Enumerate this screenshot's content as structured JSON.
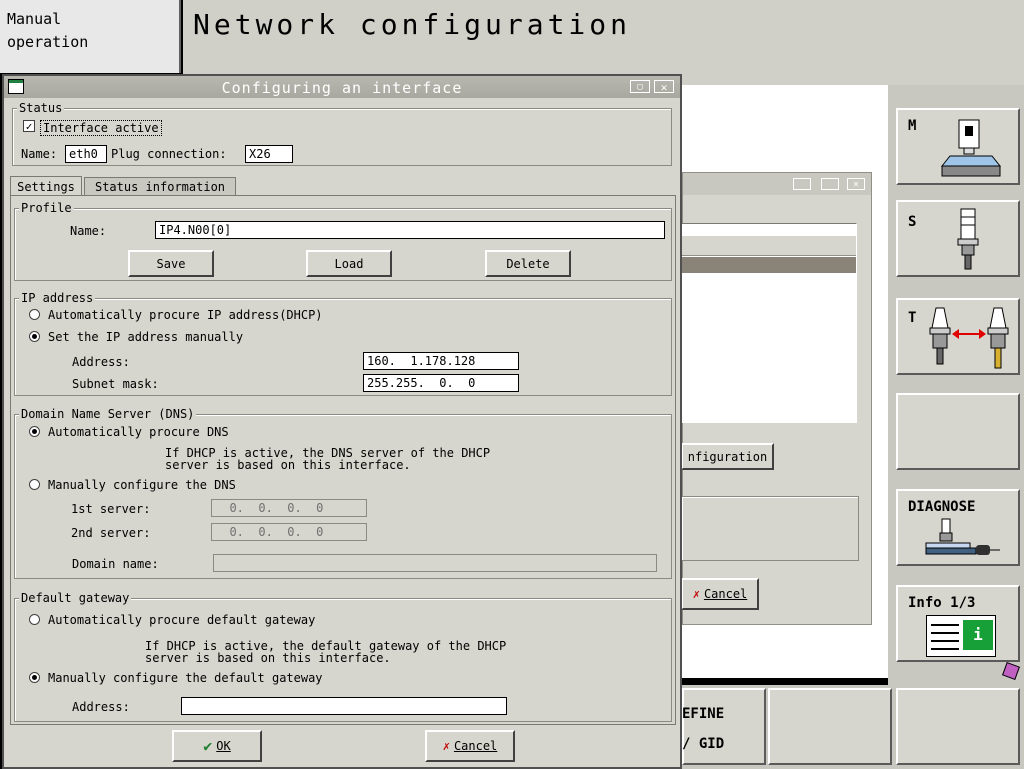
{
  "mode": {
    "line1": "Manual",
    "line2": "operation"
  },
  "screen_title": "Network configuration",
  "dialog": {
    "title": "Configuring an interface",
    "status": {
      "legend": "Status",
      "interface_active_label": "Interface active",
      "interface_active_checked": true,
      "name_label": "Name:",
      "name_value": "eth0",
      "plug_label": "Plug connection:",
      "plug_value": "X26"
    },
    "tabs": [
      "Settings",
      "Status information"
    ],
    "profile": {
      "legend": "Profile",
      "name_label": "Name:",
      "name_value": "IP4.N00[0]",
      "save": "Save",
      "load": "Load",
      "delete": "Delete"
    },
    "ip": {
      "legend": "IP address",
      "opt_auto": "Automatically procure IP address(DHCP)",
      "opt_manual": "Set the IP address manually",
      "address_label": "Address:",
      "address_value": "160.  1.178.128",
      "subnet_label": "Subnet mask:",
      "subnet_value": "255.255.  0.  0"
    },
    "dns": {
      "legend": "Domain Name Server (DNS)",
      "opt_auto": "Automatically procure DNS",
      "note_line1": "If DHCP is active, the DNS server of the DHCP",
      "note_line2": "server is based on this interface.",
      "opt_manual": "Manually configure the DNS",
      "server1_label": "1st server:",
      "server1_value": "  0.  0.  0.  0",
      "server2_label": "2nd server:",
      "server2_value": "  0.  0.  0.  0",
      "domain_label": "Domain name:",
      "domain_value": ""
    },
    "gateway": {
      "legend": "Default gateway",
      "opt_auto": "Automatically procure default gateway",
      "note_line1": "If DHCP is active, the default gateway of the DHCP",
      "note_line2": "server is based on this interface.",
      "opt_manual": "Manually configure the default gateway",
      "address_label": "Address:",
      "address_value": ""
    },
    "ok": "OK",
    "cancel": "Cancel"
  },
  "background_window": {
    "button_partial": "nfiguration",
    "cancel": "Cancel"
  },
  "softkeys_right": {
    "m": "M",
    "s": "S",
    "t": "T",
    "diagnose": "DIAGNOSE",
    "info": "Info 1/3",
    "info_glyph": "i"
  },
  "softkeys_bottom": {
    "define_line1": "EFINE",
    "define_line2": "/ GID"
  },
  "colors": {
    "accent_blue": "#0000c0",
    "info_green": "#18a038",
    "red_arrow": "#e00000"
  }
}
